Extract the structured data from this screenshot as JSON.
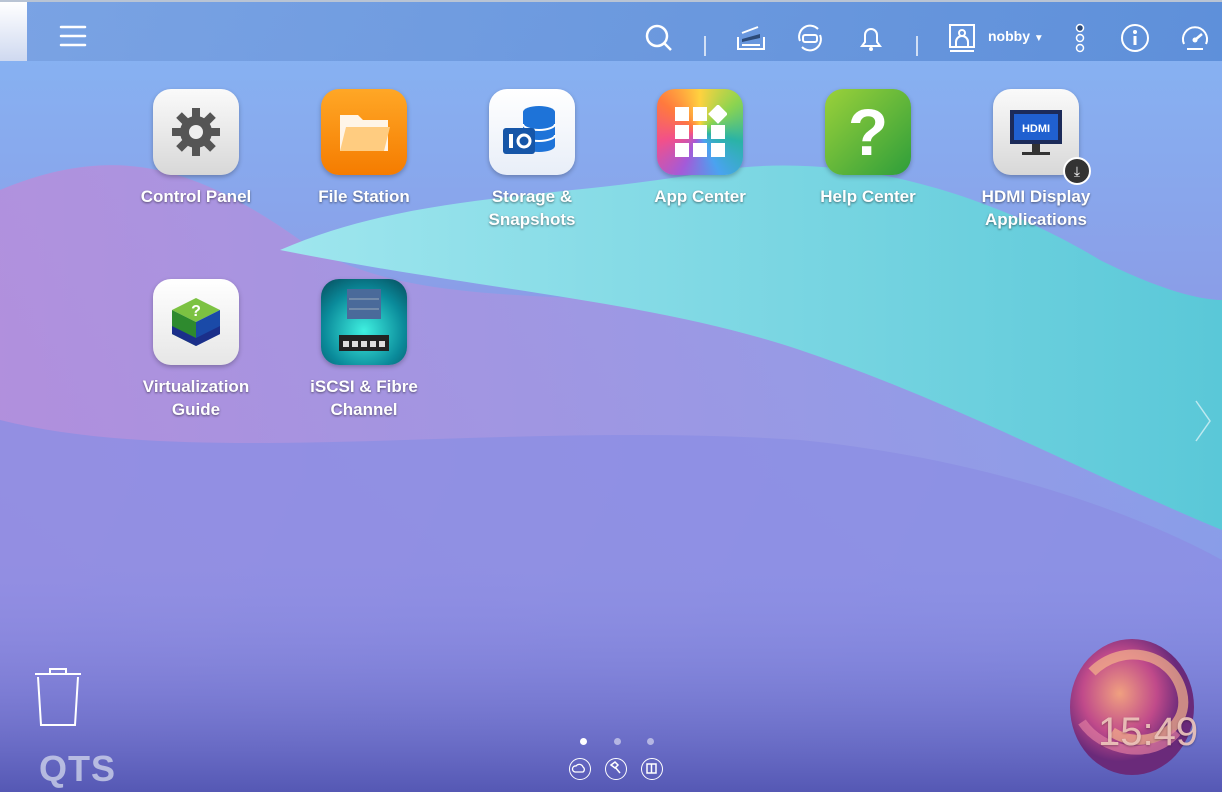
{
  "topbar": {
    "username": "nobby",
    "icons": [
      "menu-icon",
      "search-icon",
      "background-tasks-icon",
      "external-device-icon",
      "notification-bell-icon",
      "user-icon",
      "more-options-icon",
      "info-icon",
      "dashboard-icon"
    ]
  },
  "apps": [
    {
      "label": "Control Panel"
    },
    {
      "label": "File Station"
    },
    {
      "label": "Storage &\nSnapshots"
    },
    {
      "label": "App Center"
    },
    {
      "label": "Help Center"
    },
    {
      "label": "HDMI Display\nApplications"
    },
    {
      "label": "Virtualization\nGuide"
    },
    {
      "label": "iSCSI & Fibre\nChannel"
    }
  ],
  "footer": {
    "logo": "QTS",
    "clock": "15:49",
    "pages": 3,
    "current_page": 1
  },
  "colors": {
    "accent": "#5b8fd8"
  }
}
